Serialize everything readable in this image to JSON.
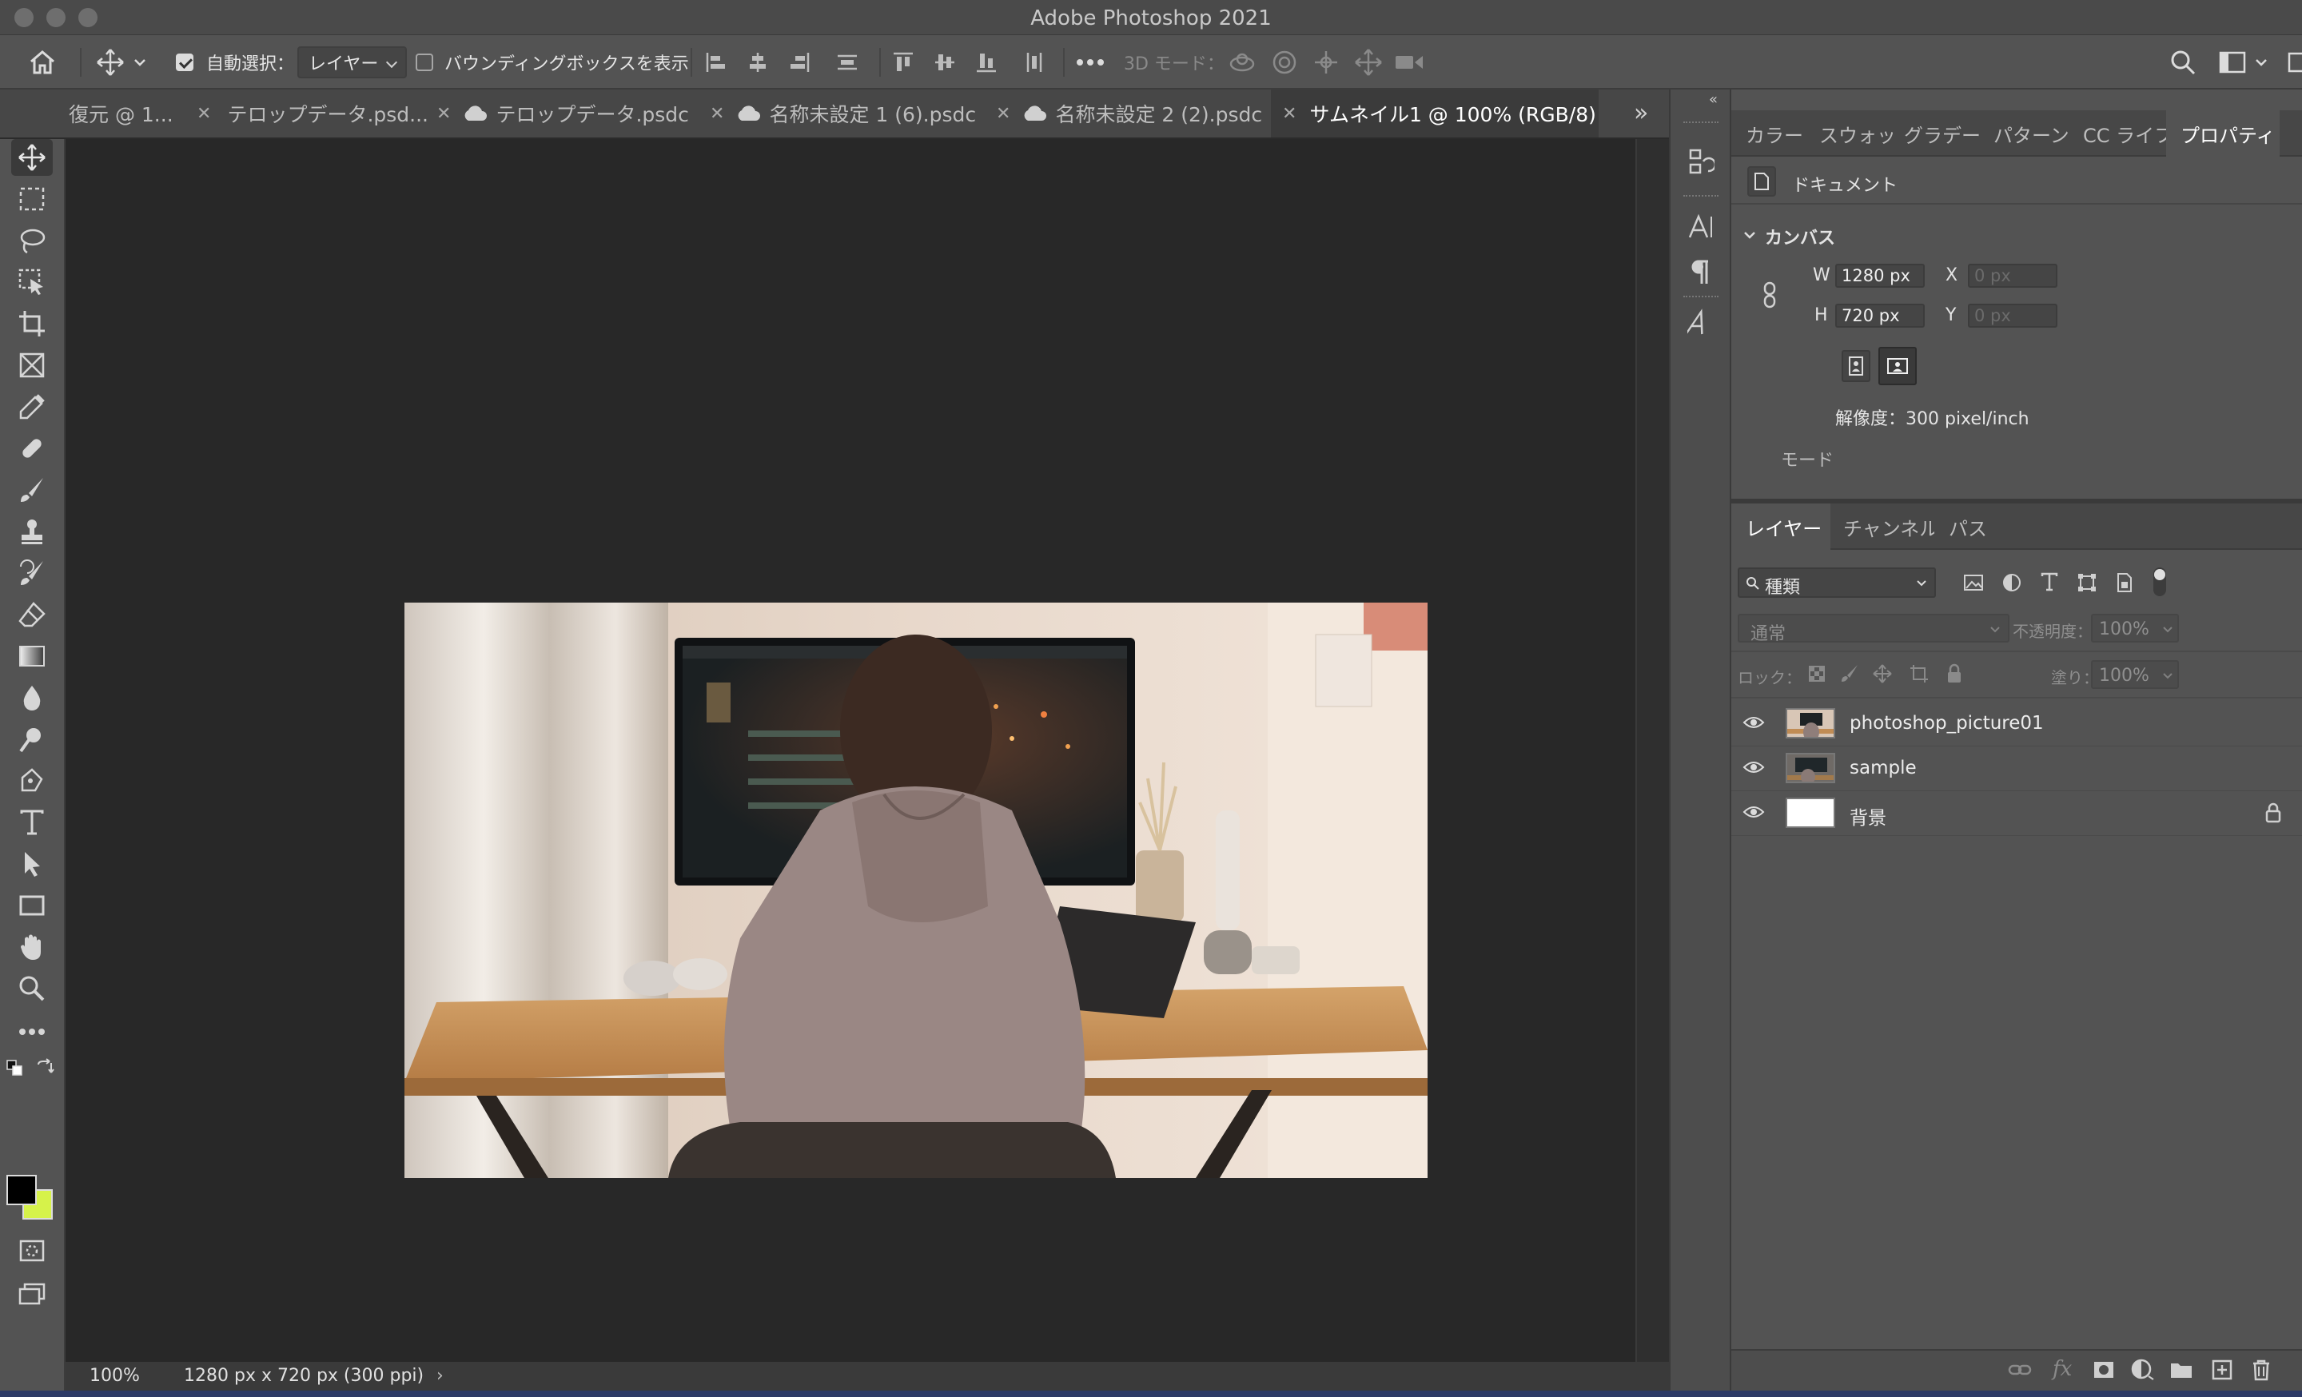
{
  "window": {
    "title": "Adobe Photoshop 2021"
  },
  "options_bar": {
    "auto_select_label": "自動選択：",
    "auto_select_value": "レイヤー",
    "bounding_box_label": "バウンディングボックスを表示",
    "mode_3d_label": "3D モード："
  },
  "tabs": [
    {
      "label": "復元 @ 1..."
    },
    {
      "label": "テロップデータ.psd..."
    },
    {
      "label": "テロップデータ.psdc"
    },
    {
      "label": "名称未設定 1 (6).psdc"
    },
    {
      "label": "名称未設定 2 (2).psdc"
    },
    {
      "label": "サムネイル1 @ 100% (RGB/8) *"
    }
  ],
  "status": {
    "zoom": "100%",
    "doc_info": "1280 px x 720 px (300 ppi)"
  },
  "properties_panel": {
    "tabs": [
      "カラー",
      "スウォッ",
      "グラデー",
      "パターン",
      "CC ライフ",
      "プロパティ"
    ],
    "doc_label": "ドキュメント",
    "canvas_header": "カンバス",
    "w_label": "W",
    "w_value": "1280 px",
    "h_label": "H",
    "h_value": "720 px",
    "x_label": "X",
    "x_value": "0 px",
    "y_label": "Y",
    "y_value": "0 px",
    "resolution": "解像度：300 pixel/inch",
    "mode_label": "モード"
  },
  "layers_panel": {
    "tabs": [
      "レイヤー",
      "チャンネル",
      "パス"
    ],
    "filter_value": "種類",
    "blend_mode": "通常",
    "opacity_label": "不透明度：",
    "opacity_value": "100%",
    "lock_label": "ロック：",
    "fill_label": "塗り：",
    "fill_value": "100%",
    "layers": [
      {
        "name": "photoshop_picture01"
      },
      {
        "name": "sample"
      },
      {
        "name": "背景"
      }
    ]
  },
  "colors": {
    "foreground": "#000000",
    "background": "#d6f24a",
    "accent": "#2d3a66"
  }
}
